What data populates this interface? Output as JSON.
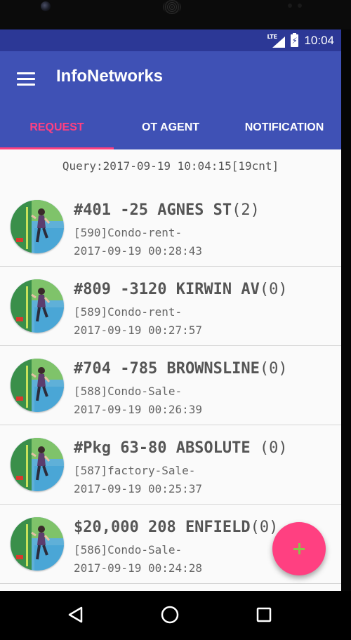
{
  "status_bar": {
    "network": "LTE",
    "time": "10:04"
  },
  "app": {
    "title": "InfoNetworks"
  },
  "tabs": [
    {
      "label": "REQUEST",
      "active": true
    },
    {
      "label": "OT AGENT",
      "active": false
    },
    {
      "label": "NOTIFICATION",
      "active": false
    }
  ],
  "query": "Query:2017-09-19 10:04:15[19cnt]",
  "items": [
    {
      "title": "#401 -25 AGNES ST",
      "count": "(2)",
      "subtitle": "[590]Condo-rent-",
      "time": "2017-09-19 00:28:43"
    },
    {
      "title": "#809 -3120 KIRWIN AV",
      "count": "(0)",
      "subtitle": "[589]Condo-rent-",
      "time": "2017-09-19 00:27:57"
    },
    {
      "title": "#704 -785 BROWNSLINE",
      "count": "(0)",
      "subtitle": "[588]Condo-Sale-",
      "time": "2017-09-19 00:26:39"
    },
    {
      "title": "#Pkg 63-80 ABSOLUTE ",
      "count": "(0)",
      "subtitle": "[587]factory-Sale-",
      "time": "2017-09-19 00:25:37"
    },
    {
      "title": "$20,000 208 ENFIELD",
      "count": "(0)",
      "subtitle": "[586]Condo-Sale-",
      "time": "2017-09-19 00:24:28"
    }
  ],
  "fab": {
    "icon": "plus-icon",
    "color": "#ff4081",
    "icon_color": "#8bc34a"
  },
  "colors": {
    "primary": "#3f51b5",
    "primary_dark": "#2c3896",
    "accent": "#ff4081"
  },
  "nav": {
    "back": "back-icon",
    "home": "home-icon",
    "recents": "recents-icon"
  }
}
